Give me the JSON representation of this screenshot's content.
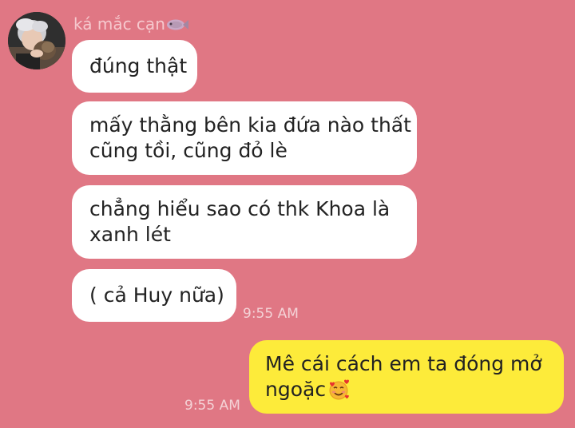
{
  "contact": {
    "name": "ká mắc cạn",
    "name_icon": "fish-icon"
  },
  "messages_received": [
    {
      "lines": [
        "đúng thật"
      ]
    },
    {
      "lines": [
        "mấy thằng bên kia đứa nào thất",
        "cũng tồi, cũng đỏ lè"
      ]
    },
    {
      "lines": [
        "chẳng hiểu sao có thk Khoa là",
        "xanh lét"
      ]
    },
    {
      "lines": [
        "( cả Huy nữa)"
      ],
      "time": "9:55 AM"
    }
  ],
  "message_sent": {
    "lines": [
      "Mê cái cách em ta đóng mở",
      "ngoặc"
    ],
    "emoji": "smiling-face-with-hearts-icon",
    "time": "9:55 AM"
  },
  "colors": {
    "background": "#e07784",
    "received_bubble": "#ffffff",
    "sent_bubble": "#fdeb3a",
    "meta_text": "#f4d2d6"
  }
}
